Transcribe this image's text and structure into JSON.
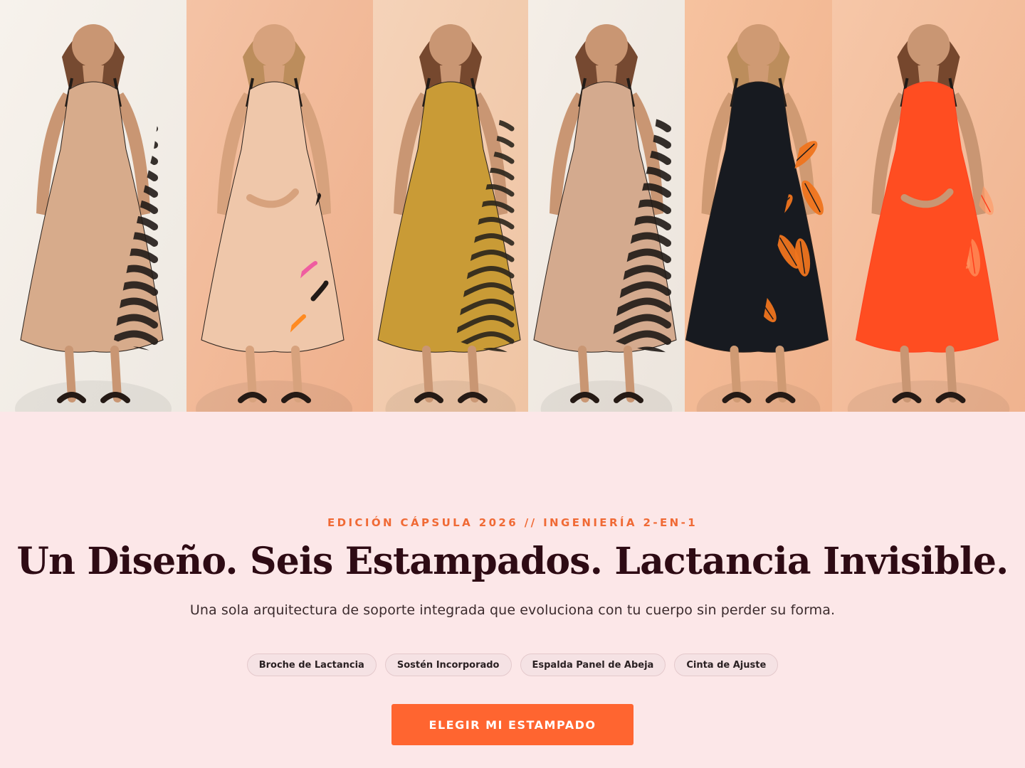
{
  "gallery": {
    "models": [
      {
        "dress": "zebra pattern",
        "pattern": "zebra",
        "bg": "#eee9e2",
        "bg2": "#f7f2ec",
        "dress_color": "#d7ab8b",
        "pattern_color": "#211b17"
      },
      {
        "dress": "brushstroke pattern",
        "pattern": "brush",
        "bg": "#efb08c",
        "bg2": "#f4c3a5",
        "dress_color": "#efc7aa",
        "pattern_color": "#2a1d1a",
        "accent_color": "#ef5da0",
        "accent_color_2": "#ff8a20"
      },
      {
        "dress": "mustard zebra pattern",
        "pattern": "gold-zebra",
        "bg": "#efc4a3",
        "bg2": "#f5d3b9",
        "dress_color": "#c99b36",
        "pattern_color": "#2a251c"
      },
      {
        "dress": "brown zebra pattern",
        "pattern": "zebra-2",
        "bg": "#ece5dd",
        "bg2": "#f4eee7",
        "dress_color": "#d4aa8e",
        "pattern_color": "#1f1a16"
      },
      {
        "dress": "orange leaf pattern",
        "pattern": "leaf-dark",
        "bg": "#f0b28c",
        "bg2": "#f6c29f",
        "dress_color": "#171a20",
        "pattern_color": "#ef741d"
      },
      {
        "dress": "orange leaf pattern",
        "pattern": "leaf-bright",
        "bg": "#f0b38f",
        "bg2": "#f6c7a8",
        "dress_color": "#ff4d21",
        "pattern_color": "#ff9a66"
      }
    ]
  },
  "hero": {
    "kicker": "EDICIÓN CÁPSULA 2026 // INGENIERÍA 2-EN-1",
    "headline": "Un Diseño. Seis Estampados. Lactancia Invisible.",
    "subtitle": "Una sola arquitectura de soporte integrada que evoluciona con tu cuerpo sin perder su forma."
  },
  "features": [
    {
      "label": "Broche de Lactancia"
    },
    {
      "label": "Sostén Incorporado"
    },
    {
      "label": "Espalda Panel de Abeja"
    },
    {
      "label": "Cinta de Ajuste"
    }
  ],
  "cta": {
    "label": "ELEGIR MI ESTAMPADO",
    "color": "#ff6530"
  },
  "colors": {
    "background": "#fce7e8",
    "accent": "#f06a35",
    "headline": "#2e0b14",
    "body_text": "#3b2b2d",
    "pill_background": "#f5e2e4",
    "pill_border": "#e4c9cc"
  }
}
